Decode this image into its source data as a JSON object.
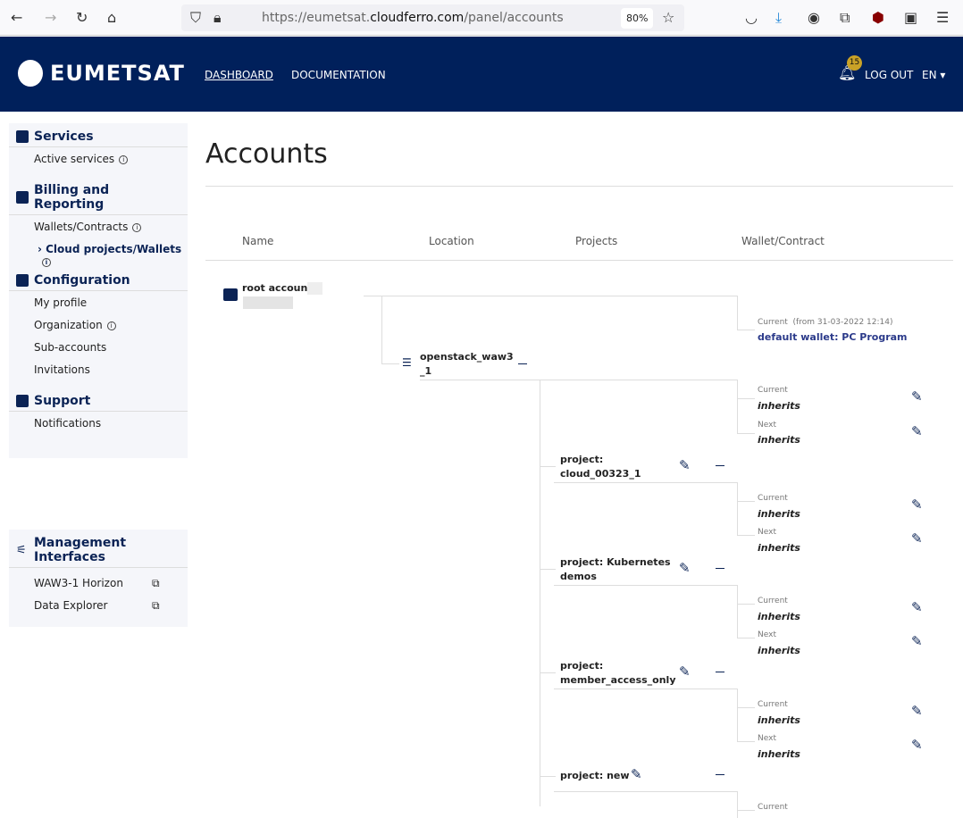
{
  "browser": {
    "url_prefix": "https://eumetsat.",
    "url_domain": "cloudferro.com",
    "url_path": "/panel/accounts",
    "zoom": "80%"
  },
  "header": {
    "brand": "EUMETSAT",
    "nav": [
      "DASHBOARD",
      "DOCUMENTATION"
    ],
    "notifications": "15",
    "logout": "LOG OUT",
    "language": "EN"
  },
  "sidebar": {
    "services": {
      "title": "Services",
      "items": [
        "Active services"
      ]
    },
    "billing": {
      "title": "Billing and Reporting",
      "items": [
        "Wallets/Contracts",
        "Cloud projects/Wallets"
      ]
    },
    "configuration": {
      "title": "Configuration",
      "items": [
        "My profile",
        "Organization",
        "Sub-accounts",
        "Invitations"
      ]
    },
    "support": {
      "title": "Support",
      "items": [
        "Notifications"
      ]
    },
    "management": {
      "title": "Management Interfaces",
      "items": [
        "WAW3-1 Horizon",
        "Data Explorer"
      ]
    }
  },
  "main": {
    "title": "Accounts",
    "columns": [
      "Name",
      "Location",
      "Projects",
      "Wallet/Contract"
    ],
    "root": {
      "label": "root account:",
      "wallet_current_label": "Current",
      "wallet_from": "(from 31-03-2022 12:14)",
      "wallet": "default wallet: PC Program"
    },
    "region": {
      "label": "openstack_waw3_1",
      "line1": "openstack_waw3",
      "line2": "_1",
      "current_label": "Current",
      "current": "inherits",
      "next_label": "Next",
      "next": "inherits"
    },
    "projects": [
      {
        "line1": "project:",
        "line2": "cloud_00323_1",
        "current_label": "Current",
        "current": "inherits",
        "next_label": "Next",
        "next": "inherits"
      },
      {
        "line1": "project: Kubernetes",
        "line2": "demos",
        "current_label": "Current",
        "current": "inherits",
        "next_label": "Next",
        "next": "inherits"
      },
      {
        "line1": "project:",
        "line2": "member_access_only",
        "current_label": "Current",
        "current": "inherits",
        "next_label": "Next",
        "next": "inherits"
      },
      {
        "line1": "project: new",
        "line2": "",
        "current_label": "Current",
        "current": "",
        "next_label": "",
        "next": ""
      }
    ]
  }
}
